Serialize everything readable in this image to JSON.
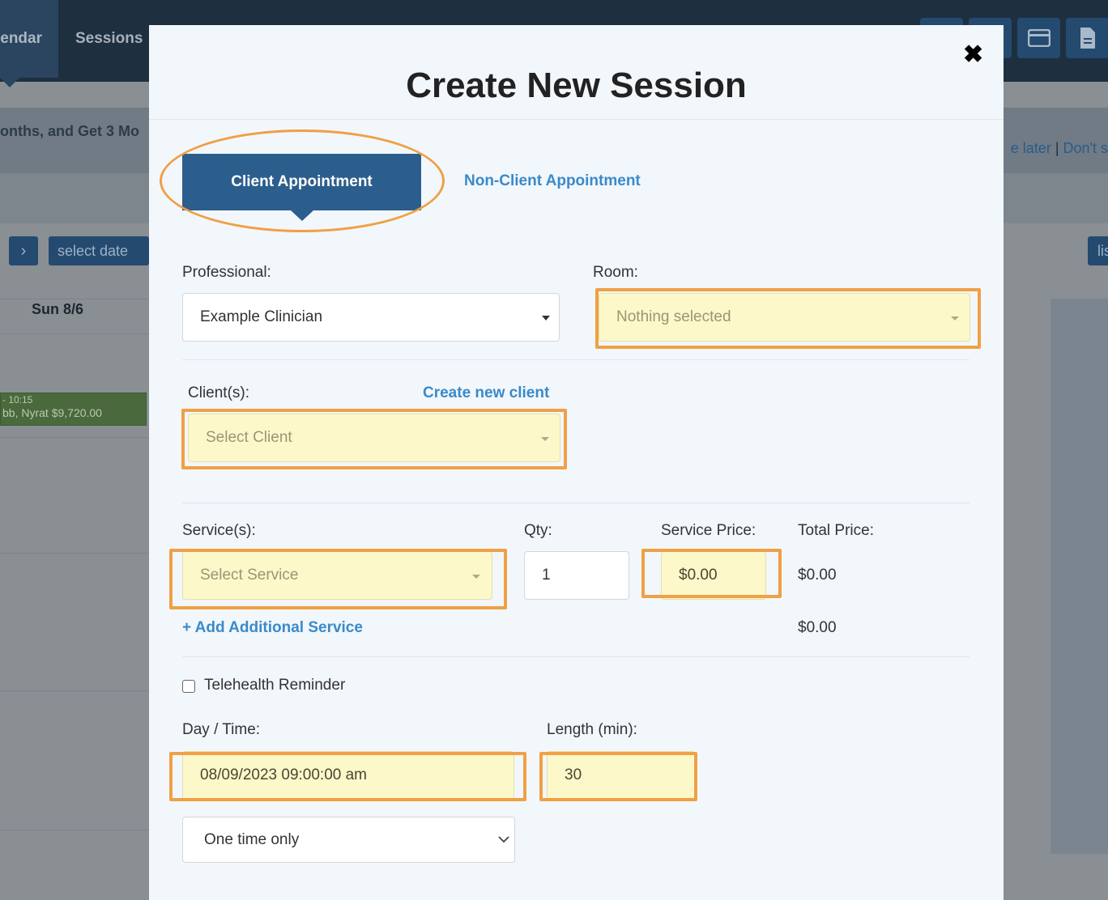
{
  "background": {
    "nav": {
      "calendar_label": "endar",
      "sessions_label": "Sessions"
    },
    "top_icons": [
      "icon-button",
      "calendar-icon",
      "credit-card-icon",
      "document-icon"
    ],
    "promo_text": "onths, and Get 3 Mo",
    "promo_right_prefix": "e later",
    "promo_separator": "|",
    "promo_right_link": "Don't s",
    "next_arrow": "›",
    "select_date_label": "select date",
    "right_button_label": "lis",
    "day_header": "Sun 8/6",
    "event": {
      "time": "- 10:15",
      "text": "bb, Nyrat $9,720.00",
      "color": "#4a6a3d"
    }
  },
  "modal": {
    "title": "Create New Session",
    "close_glyph": "✖",
    "tabs": [
      {
        "label": "Client Appointment",
        "active": true
      },
      {
        "label": "Non-Client Appointment",
        "active": false
      }
    ],
    "professional": {
      "label": "Professional:",
      "value": "Example Clinician"
    },
    "room": {
      "label": "Room:",
      "placeholder": "Nothing selected"
    },
    "clients": {
      "label": "Client(s):",
      "create_link": "Create new client",
      "placeholder": "Select Client"
    },
    "service": {
      "label": "Service(s):",
      "placeholder": "Select Service",
      "qty_label": "Qty:",
      "qty_value": "1",
      "price_label": "Service Price:",
      "price_value": "$0.00",
      "total_label": "Total Price:",
      "total_value": "$0.00",
      "add_link": "+ Add Additional Service",
      "grand_total": "$0.00"
    },
    "telehealth": {
      "label": "Telehealth Reminder",
      "checked": false
    },
    "day_time": {
      "label": "Day / Time:",
      "value": "08/09/2023 09:00:00 am"
    },
    "length": {
      "label": "Length (min):",
      "value": "30"
    },
    "recurrence": {
      "value": "One time only"
    }
  },
  "colors": {
    "highlight": "#f0a045",
    "primary": "#2b5e8c",
    "link": "#3a8ac9",
    "field_highlight": "#fdf8c9"
  }
}
